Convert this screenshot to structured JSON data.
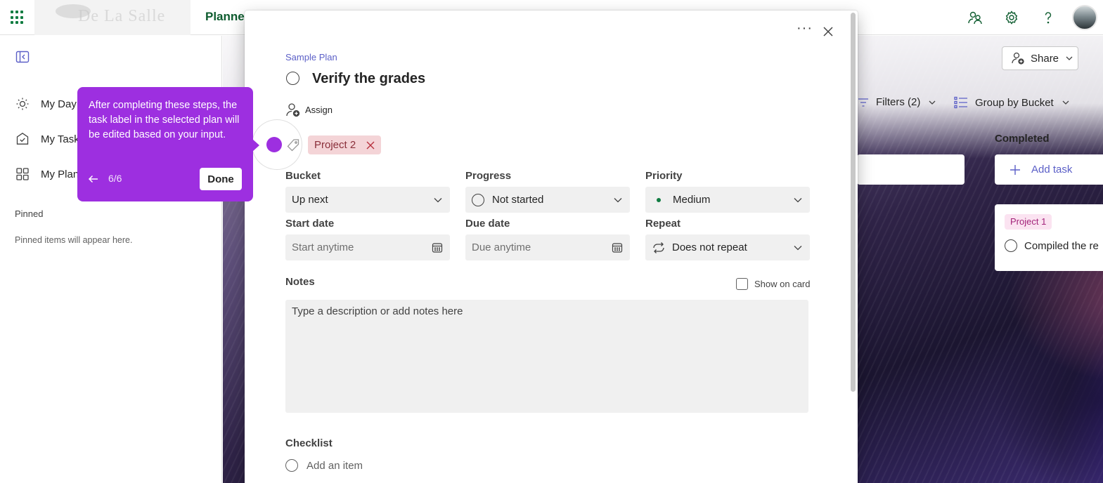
{
  "topbar": {
    "app_name": "Planner",
    "logo_text": "De La Salle"
  },
  "sidebar": {
    "items": [
      {
        "label": "My Day",
        "icon": "sun-icon"
      },
      {
        "label": "My Tasks",
        "icon": "tasks-icon"
      },
      {
        "label": "My Plans",
        "icon": "grid-icon"
      }
    ],
    "pinned_heading": "Pinned",
    "pinned_empty": "Pinned items will appear here."
  },
  "board": {
    "share_label": "Share",
    "filters_label": "Filters (2)",
    "group_by_label": "Group by Bucket",
    "bucket_title": "Completed",
    "add_task_label": "Add task",
    "card_label": "Project 1",
    "card_task": "Compiled the re"
  },
  "task": {
    "plan_name": "Sample Plan",
    "title": "Verify the grades",
    "assign_label": "Assign",
    "label_chip": "Project 2",
    "bucket_label": "Bucket",
    "bucket_value": "Up next",
    "progress_label": "Progress",
    "progress_value": "Not started",
    "priority_label": "Priority",
    "priority_value": "Medium",
    "start_label": "Start date",
    "start_placeholder": "Start anytime",
    "due_label": "Due date",
    "due_placeholder": "Due anytime",
    "repeat_label": "Repeat",
    "repeat_value": "Does not repeat",
    "notes_label": "Notes",
    "show_on_card": "Show on card",
    "notes_placeholder": "Type a description or add notes here",
    "checklist_label": "Checklist",
    "add_item": "Add an item"
  },
  "tour": {
    "text": "After completing these steps, the task label in the selected plan will be edited based on your input.",
    "step": "6/6",
    "done_label": "Done"
  },
  "colors": {
    "accent": "#5b5fc7",
    "brand": "#107c41",
    "tour": "#9d2fe0",
    "label_chip_bg": "#f4d4d7",
    "priority_dot": "#107c41"
  }
}
